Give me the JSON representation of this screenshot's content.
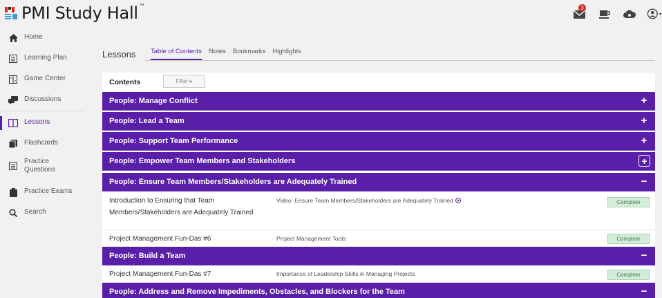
{
  "app": {
    "name": "PMI Study Hall",
    "tm": "™"
  },
  "header": {
    "notification_count": "3"
  },
  "sidebar": {
    "items": [
      {
        "label": "Home",
        "icon": "home-icon"
      },
      {
        "label": "Learning Plan",
        "icon": "calendar-icon"
      },
      {
        "label": "Game Center",
        "icon": "game-icon"
      },
      {
        "label": "Discussions",
        "icon": "chat-icon"
      },
      {
        "label": "Lessons",
        "icon": "book-icon",
        "active": true
      },
      {
        "label": "Flashcards",
        "icon": "flashcards-icon"
      },
      {
        "label": "Practice Questions",
        "icon": "list-icon"
      },
      {
        "label": "Practice Exams",
        "icon": "clipboard-icon"
      },
      {
        "label": "Search",
        "icon": "search-icon"
      }
    ]
  },
  "page": {
    "title": "Lessons",
    "tabs": [
      "Table of Contents",
      "Notes",
      "Bookmarks",
      "Highlights"
    ],
    "active_tab": "Table of Contents"
  },
  "contents": {
    "label": "Contents",
    "filter_label": "Filter ▸",
    "sections": [
      {
        "title": "People: Manage Conflict",
        "toggle": "+"
      },
      {
        "title": "People: Lead a Team",
        "toggle": "+"
      },
      {
        "title": "People: Support Team Performance",
        "toggle": "+"
      },
      {
        "title": "People: Empower Team Members and Stakeholders",
        "toggle": "+"
      },
      {
        "title": "People: Ensure Team Members/Stakeholders are Adequately Trained",
        "toggle": "−",
        "lessons": [
          {
            "title": "Introduction to Ensuring that Team Members/Stakeholders are Adequately Trained",
            "desc": "Video: Ensure Team Members/Stakeholders are Adequately Trained",
            "status": "Complete"
          },
          {
            "title": "Project Management Fun-Das #6",
            "desc": "Project Management Tools",
            "status": "Complete"
          }
        ]
      },
      {
        "title": "People: Build a Team",
        "toggle": "−",
        "lessons": [
          {
            "title": "Project Management Fun-Das #7",
            "desc": "Importance of Leadership Skills in Managing Projects",
            "status": "Complete"
          }
        ]
      },
      {
        "title": "People: Address and Remove Impediments, Obstacles, and Blockers for the Team",
        "toggle": "−"
      }
    ]
  },
  "colors": {
    "primary": "#5a1fa8",
    "complete_bg": "#d4ecd9",
    "badge": "#d5282f"
  }
}
